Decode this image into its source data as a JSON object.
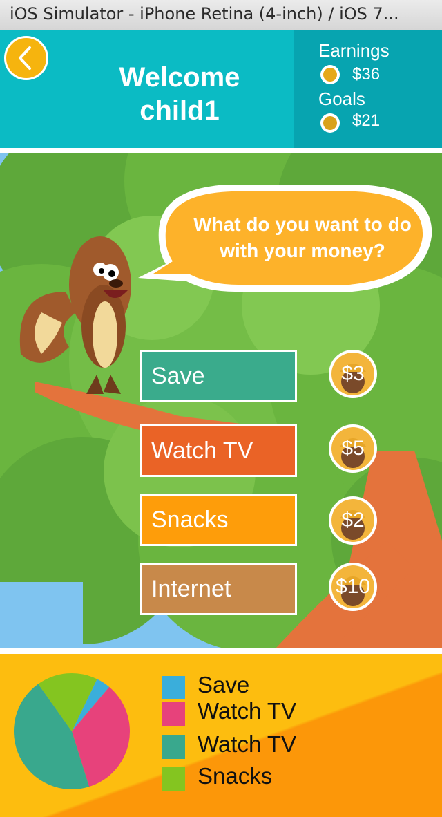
{
  "window": {
    "title": "iOS Simulator - iPhone Retina (4-inch) / iOS 7..."
  },
  "header": {
    "welcome_line1": "Welcome",
    "welcome_line2": "child1",
    "earnings_label": "Earnings",
    "earnings_value": "$36",
    "goals_label": "Goals",
    "goals_value": "$21",
    "back_icon": "chevron-left-icon"
  },
  "speech_bubble": {
    "text": "What do you want to do with your money?"
  },
  "choices": [
    {
      "label": "Save",
      "cost": "$3",
      "color": "#3aab8c"
    },
    {
      "label": "Watch TV",
      "cost": "$5",
      "color": "#ea6326"
    },
    {
      "label": "Snacks",
      "cost": "$2",
      "color": "#fe9d0a"
    },
    {
      "label": "Internet",
      "cost": "$10",
      "color": "#c8894a"
    }
  ],
  "legend": [
    {
      "label": "Save",
      "color": "#3aaedb"
    },
    {
      "label": "Watch TV",
      "color": "#e7427b"
    },
    {
      "label": "Watch TV",
      "color": "#39a88d"
    },
    {
      "label": "Snacks",
      "color": "#84c520"
    }
  ],
  "chart_data": {
    "type": "pie",
    "slices": [
      {
        "color": "#3aaedb",
        "value": 4
      },
      {
        "color": "#e7427b",
        "value": 34
      },
      {
        "color": "#39a88d",
        "value": 45
      },
      {
        "color": "#84c520",
        "value": 17
      }
    ]
  },
  "colors": {
    "header": "#0bbbc4",
    "header_right": "#07a4b0",
    "accent": "#f6b40e",
    "footer_light": "#fdbd0f",
    "footer_dark": "#fc9709"
  }
}
